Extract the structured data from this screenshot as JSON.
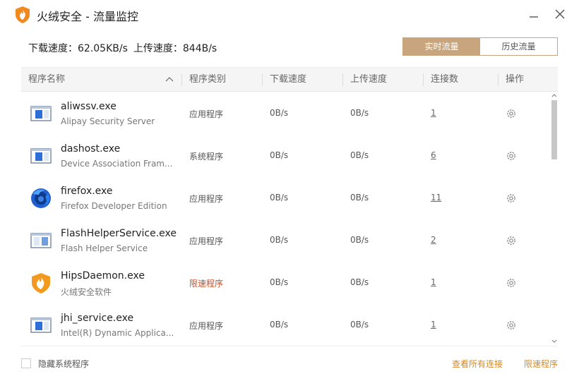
{
  "window": {
    "title": "火绒安全 - 流量监控",
    "accent_color": "#c8a57c",
    "link_color": "#d08a2e",
    "limited_color": "#c8502a"
  },
  "speed": {
    "download_label": "下载速度：",
    "download_value": "62.05KB/s",
    "upload_label": "上传速度：",
    "upload_value": "844B/s"
  },
  "tabs": [
    {
      "label": "实时流量",
      "active": true
    },
    {
      "label": "历史流量",
      "active": false
    }
  ],
  "columns": {
    "name": "程序名称",
    "type": "程序类别",
    "download": "下载速度",
    "upload": "上传速度",
    "connections": "连接数",
    "action": "操作"
  },
  "rows": [
    {
      "icon": "window-app-icon",
      "name": "aliwssv.exe",
      "desc": "Alipay Security Server",
      "type": "应用程序",
      "down": "0B/s",
      "up": "0B/s",
      "conn": "1"
    },
    {
      "icon": "window-app-icon",
      "name": "dashost.exe",
      "desc": "Device Association Fram...",
      "type": "系统程序",
      "down": "0B/s",
      "up": "0B/s",
      "conn": "6"
    },
    {
      "icon": "firefox-icon",
      "name": "firefox.exe",
      "desc": "Firefox Developer Edition",
      "type": "应用程序",
      "down": "0B/s",
      "up": "0B/s",
      "conn": "11"
    },
    {
      "icon": "window-app-icon",
      "name": "FlashHelperService.exe",
      "desc": "Flash Helper Service",
      "type": "应用程序",
      "down": "0B/s",
      "up": "0B/s",
      "conn": "2"
    },
    {
      "icon": "huorong-shield-icon",
      "name": "HipsDaemon.exe",
      "desc": "火绒安全软件",
      "type": "限速程序",
      "down": "0B/s",
      "up": "0B/s",
      "conn": "1",
      "limited": true
    },
    {
      "icon": "window-app-icon",
      "name": "jhi_service.exe",
      "desc": "Intel(R) Dynamic Applica...",
      "type": "应用程序",
      "down": "0B/s",
      "up": "0B/s",
      "conn": "1"
    }
  ],
  "footer": {
    "hide_system_label": "隐藏系统程序",
    "view_all_link": "查看所有连接",
    "limit_link": "限速程序"
  }
}
